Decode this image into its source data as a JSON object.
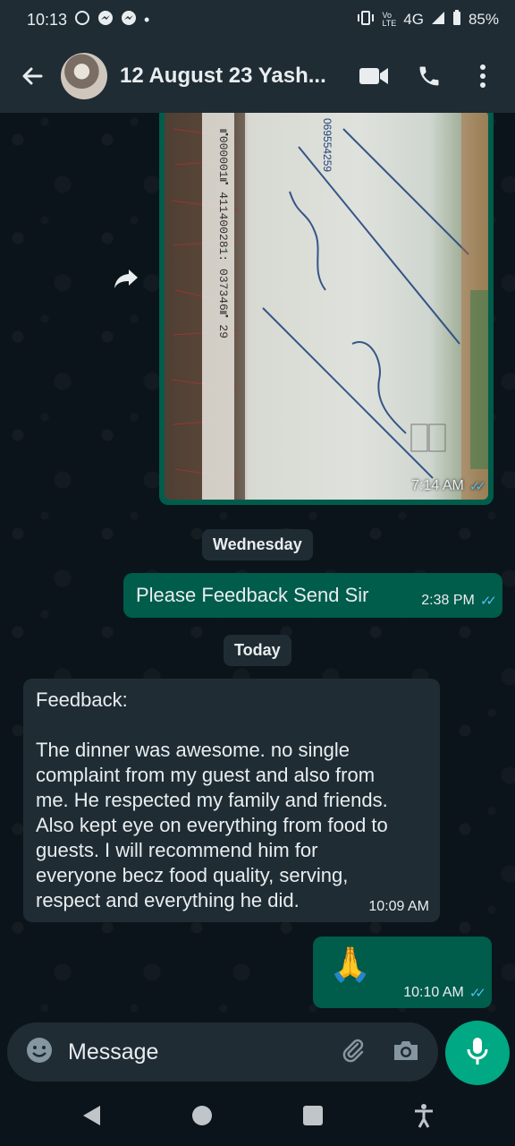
{
  "status_bar": {
    "time": "10:13",
    "network": "4G",
    "battery": "85%"
  },
  "header": {
    "contact_name": "12 August 23 Yash..."
  },
  "messages": [
    {
      "type": "image",
      "direction": "outgoing",
      "time": "7:14 AM"
    },
    {
      "type": "date",
      "text": "Wednesday"
    },
    {
      "type": "text",
      "direction": "outgoing",
      "text": "Please Feedback Send Sir",
      "time": "2:38 PM"
    },
    {
      "type": "date",
      "text": "Today"
    },
    {
      "type": "text",
      "direction": "incoming",
      "lines": [
        "Feedback:",
        "",
        "The dinner was awesome. no single",
        "complaint from my guest and also from",
        "me. He respected my family and friends.",
        "Also kept eye on everything from food to",
        "guests. I will recommend him for",
        "everyone becz food quality, serving,",
        "respect and everything he did."
      ],
      "time": "10:09 AM"
    },
    {
      "type": "emoji",
      "direction": "outgoing",
      "text": "🙏",
      "time": "10:10 AM"
    }
  ],
  "composer": {
    "placeholder": "Message"
  },
  "colors": {
    "outgoing": "#005c4b",
    "incoming": "#1f2c34",
    "accent": "#00a884",
    "read_tick": "#53bdeb"
  }
}
